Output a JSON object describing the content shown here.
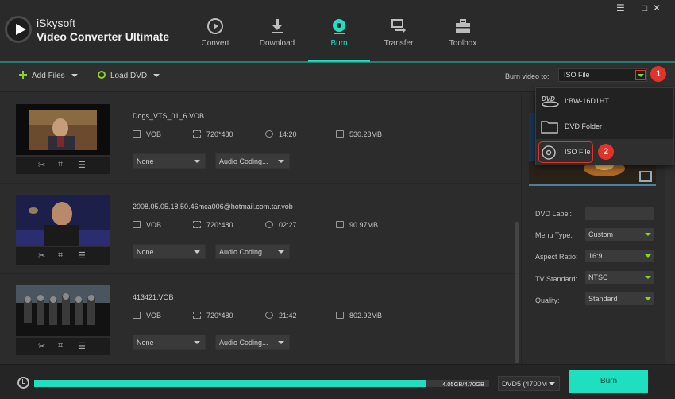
{
  "app": {
    "brand_line1": "iSkysoft",
    "brand_line2": "Video Converter Ultimate",
    "window_controls": [
      "☰",
      "□",
      "✕"
    ]
  },
  "nav": [
    {
      "label": "Convert",
      "icon": "convert-icon",
      "active": false
    },
    {
      "label": "Download",
      "icon": "download-icon",
      "active": false
    },
    {
      "label": "Burn",
      "icon": "burn-icon",
      "active": true
    },
    {
      "label": "Transfer",
      "icon": "transfer-icon",
      "active": false
    },
    {
      "label": "Toolbox",
      "icon": "toolbox-icon",
      "active": false
    }
  ],
  "toolbar": {
    "add_files": "Add Files",
    "load_dvd": "Load DVD",
    "burn_video_to_label": "Burn video to:",
    "burn_video_to_value": "ISO File",
    "step1": "1"
  },
  "files": [
    {
      "name": "Dogs_VTS_01_6.VOB",
      "format": "VOB",
      "resolution": "720*480",
      "duration": "14:20",
      "size": "530.23MB",
      "subtitle": "None",
      "audio": "Audio Coding..."
    },
    {
      "name": "2008.05.05.18.50.46mca006@hotmail.com.tar.vob",
      "format": "VOB",
      "resolution": "720*480",
      "duration": "02:27",
      "size": "90.97MB",
      "subtitle": "None",
      "audio": "Audio Coding..."
    },
    {
      "name": "413421.VOB",
      "format": "VOB",
      "resolution": "720*480",
      "duration": "21:42",
      "size": "802.92MB",
      "subtitle": "None",
      "audio": "Audio Coding..."
    }
  ],
  "dropdown_menu": {
    "items": [
      {
        "label": "I:BW-16D1HT",
        "icon": "dvd-drive-icon"
      },
      {
        "label": "DVD Folder",
        "icon": "folder-icon"
      },
      {
        "label": "ISO File",
        "icon": "disc-icon"
      }
    ],
    "step2": "2"
  },
  "settings": {
    "dvd_label": {
      "label": "DVD Label:",
      "value": ""
    },
    "menu_type": {
      "label": "Menu Type:",
      "value": "Custom"
    },
    "aspect_ratio": {
      "label": "Aspect Ratio:",
      "value": "16:9"
    },
    "tv_standard": {
      "label": "TV Standard:",
      "value": "NTSC"
    },
    "quality": {
      "label": "Quality:",
      "value": "Standard"
    }
  },
  "bottom": {
    "progress_text": "4.05GB/4.70GB",
    "progress_fraction": 0.862,
    "disc_type": "DVD5 (4700M",
    "burn_button": "Burn"
  },
  "colors": {
    "accent": "#22e0c3",
    "highlight_red": "#e0342b",
    "icon_green": "#8bd12c"
  }
}
